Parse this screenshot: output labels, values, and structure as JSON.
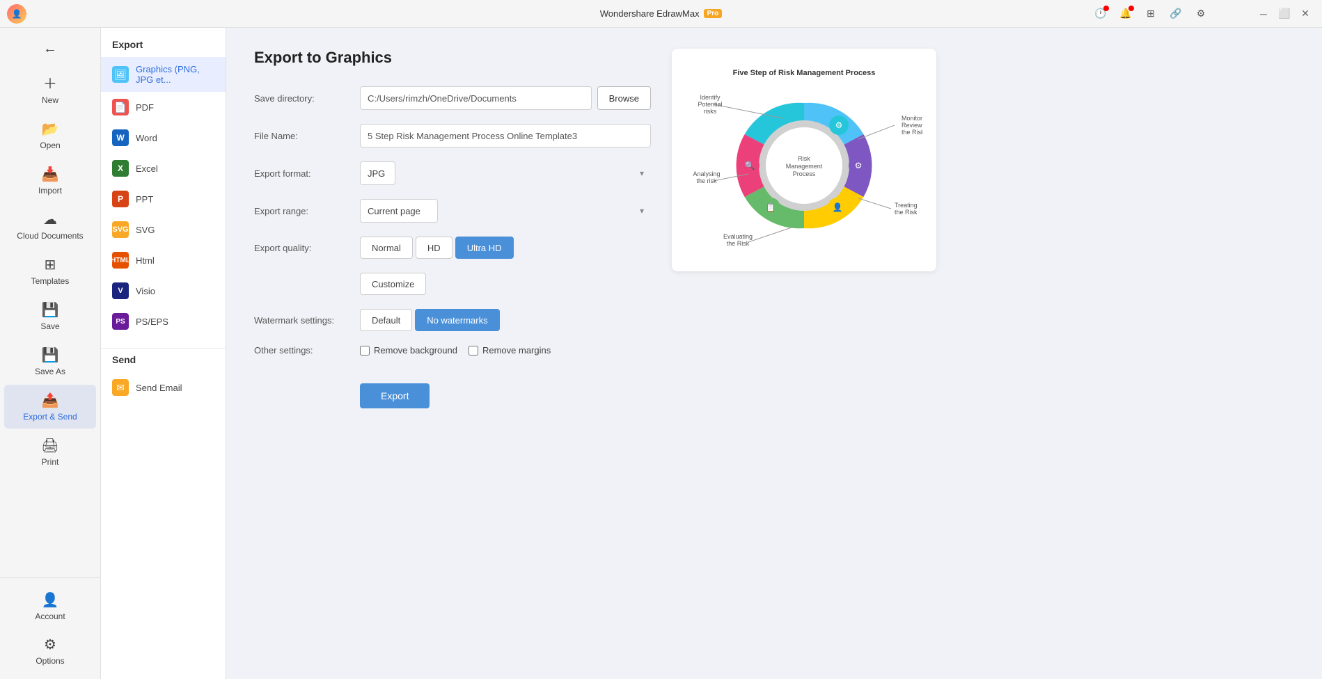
{
  "titlebar": {
    "title": "Wondershare EdrawMax",
    "pro_badge": "Pro"
  },
  "sidebar": {
    "items": [
      {
        "id": "new",
        "label": "New",
        "icon": "+"
      },
      {
        "id": "open",
        "label": "Open",
        "icon": "📂"
      },
      {
        "id": "import",
        "label": "Import",
        "icon": "📥"
      },
      {
        "id": "cloud",
        "label": "Cloud Documents",
        "icon": "☁"
      },
      {
        "id": "templates",
        "label": "Templates",
        "icon": "⊞"
      },
      {
        "id": "save",
        "label": "Save",
        "icon": "💾"
      },
      {
        "id": "save-as",
        "label": "Save As",
        "icon": "💾"
      },
      {
        "id": "export-send",
        "label": "Export & Send",
        "icon": "📤"
      },
      {
        "id": "print",
        "label": "Print",
        "icon": "🖨"
      }
    ],
    "bottom_items": [
      {
        "id": "account",
        "label": "Account",
        "icon": "👤"
      },
      {
        "id": "options",
        "label": "Options",
        "icon": "⚙"
      }
    ]
  },
  "export_panel": {
    "title": "Export",
    "items": [
      {
        "id": "graphics",
        "label": "Graphics (PNG, JPG et...",
        "icon_type": "png",
        "icon_text": "🖼"
      },
      {
        "id": "pdf",
        "label": "PDF",
        "icon_type": "pdf",
        "icon_text": "📄"
      },
      {
        "id": "word",
        "label": "Word",
        "icon_type": "word",
        "icon_text": "W"
      },
      {
        "id": "excel",
        "label": "Excel",
        "icon_type": "excel",
        "icon_text": "X"
      },
      {
        "id": "ppt",
        "label": "PPT",
        "icon_type": "ppt",
        "icon_text": "P"
      },
      {
        "id": "svg",
        "label": "SVG",
        "icon_type": "svg",
        "icon_text": "S"
      },
      {
        "id": "html",
        "label": "Html",
        "icon_type": "html",
        "icon_text": "H"
      },
      {
        "id": "visio",
        "label": "Visio",
        "icon_type": "visio",
        "icon_text": "V"
      },
      {
        "id": "pseps",
        "label": "PS/EPS",
        "icon_type": "pseps",
        "icon_text": "PS"
      }
    ],
    "send_title": "Send",
    "send_items": [
      {
        "id": "email",
        "label": "Send Email",
        "icon_type": "email",
        "icon_text": "✉"
      }
    ]
  },
  "form": {
    "page_title": "Export to Graphics",
    "save_directory_label": "Save directory:",
    "save_directory_value": "C:/Users/rimzh/OneDrive/Documents",
    "file_name_label": "File Name:",
    "file_name_value": "5 Step Risk Management Process Online Template3",
    "export_format_label": "Export format:",
    "export_format_value": "JPG",
    "export_range_label": "Export range:",
    "export_range_value": "Current page",
    "export_quality_label": "Export quality:",
    "quality_options": [
      {
        "id": "normal",
        "label": "Normal",
        "active": false
      },
      {
        "id": "hd",
        "label": "HD",
        "active": false
      },
      {
        "id": "ultrahd",
        "label": "Ultra HD",
        "active": true
      },
      {
        "id": "customize",
        "label": "Customize",
        "active": false
      }
    ],
    "watermark_label": "Watermark settings:",
    "watermark_options": [
      {
        "id": "default",
        "label": "Default",
        "active": false
      },
      {
        "id": "no-watermarks",
        "label": "No watermarks",
        "active": true
      }
    ],
    "other_settings_label": "Other settings:",
    "remove_background_label": "Remove background",
    "remove_margins_label": "Remove margins",
    "browse_label": "Browse",
    "export_button_label": "Export"
  },
  "preview": {
    "chart_title": "Five Step of Risk Management Process",
    "segments": [
      {
        "label": "Identify Potential risks",
        "color": "#4fc3f7"
      },
      {
        "label": "Monitoring Reviewing the Risk",
        "color": "#7e57c2"
      },
      {
        "label": "Treating the Risk",
        "color": "#ffcc02"
      },
      {
        "label": "Evaluating the Risk",
        "color": "#66bb6a"
      },
      {
        "label": "Analysing the risk",
        "color": "#ec407a"
      }
    ],
    "center_label": "Risk Management Process"
  }
}
